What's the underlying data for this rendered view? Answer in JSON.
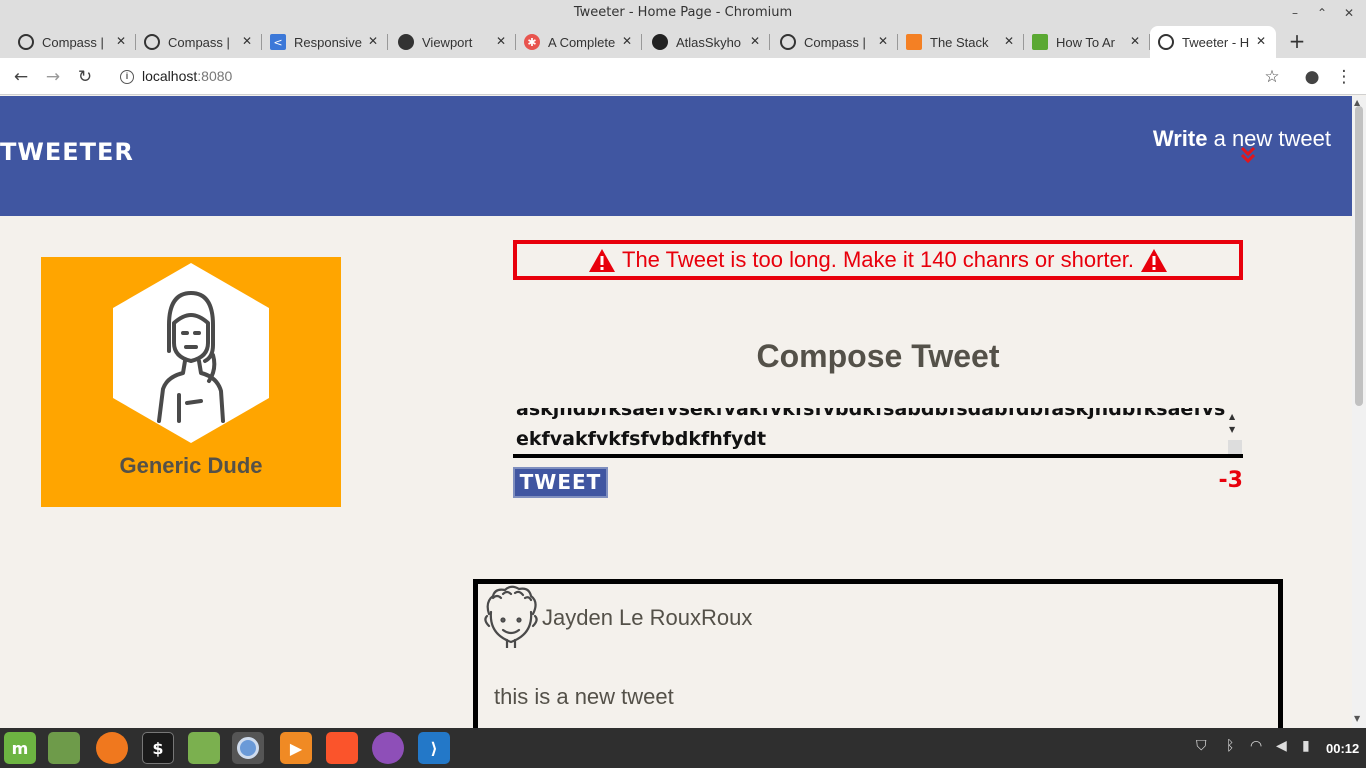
{
  "window": {
    "title": "Tweeter - Home Page - Chromium"
  },
  "tabs": [
    {
      "label": "Compass |",
      "icon": "globe-icon",
      "active": false
    },
    {
      "label": "Compass |",
      "icon": "globe-icon",
      "active": false
    },
    {
      "label": "Responsive",
      "icon": "responsive-icon",
      "active": false
    },
    {
      "label": "Viewport",
      "icon": "viewport-icon",
      "active": false
    },
    {
      "label": "A Complete",
      "icon": "star-burst-icon",
      "active": false
    },
    {
      "label": "AtlasSkyho",
      "icon": "github-icon",
      "active": false
    },
    {
      "label": "Compass |",
      "icon": "globe-icon",
      "active": false
    },
    {
      "label": "The Stack",
      "icon": "stack-icon",
      "active": false
    },
    {
      "label": "How To Ar",
      "icon": "howto-icon",
      "active": false
    },
    {
      "label": "Tweeter - H",
      "icon": "globe-icon",
      "active": true
    }
  ],
  "address_bar": {
    "host": "localhost",
    "port": ":8080"
  },
  "site": {
    "logo": "TWEETER",
    "nav_write_bold": "Write",
    "nav_write_rest": " a new tweet",
    "toggle_arrow": "»"
  },
  "profile": {
    "name": "Generic Dude"
  },
  "compose": {
    "error_message": "The Tweet is too long. Make it 140 chanrs or shorter.",
    "title": "Compose Tweet",
    "text_line1": "askjndbfksaefvsekfvakfvkfsfvbdkfsabdbfsdabfdbfaskjndbfksaefvs",
    "text_line2": "ekfvakfvkfsfvbdkfhfydt",
    "button_label": "TWEET",
    "counter": "-3"
  },
  "tweets": [
    {
      "author": "Jayden Le RouxRoux",
      "body": "this is a new tweet"
    }
  ],
  "taskbar": {
    "clock": "00:12"
  },
  "colors": {
    "header_bg": "#4056a1",
    "accent_red": "#e8000c",
    "profile_bg": "#ffa500",
    "page_bg": "#f4f1ec"
  }
}
